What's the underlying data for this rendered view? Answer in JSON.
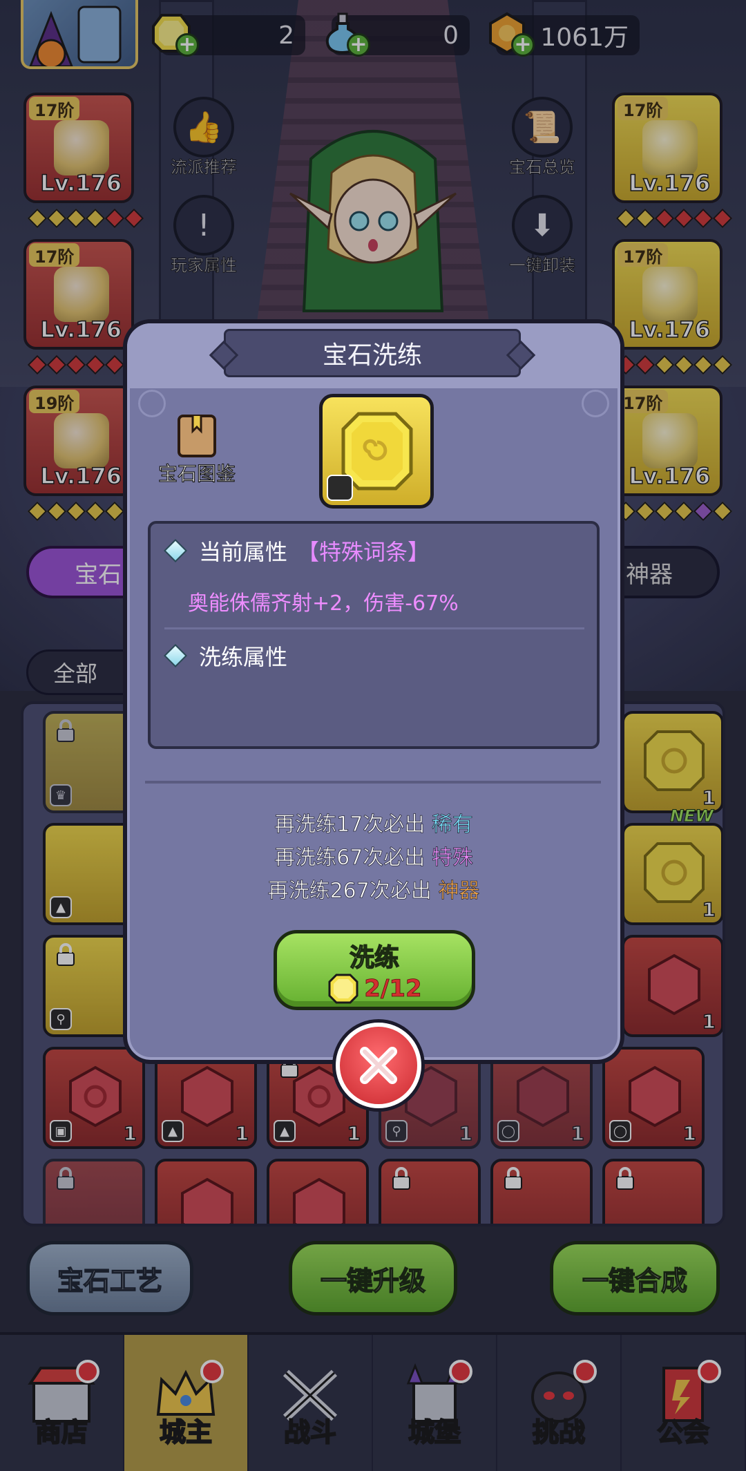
{
  "currencies": [
    {
      "name": "gold-gem-currency",
      "value": "2"
    },
    {
      "name": "potion-currency",
      "value": "0"
    },
    {
      "name": "coin-currency",
      "value": "1061万"
    }
  ],
  "equipment_left": [
    {
      "tier": "17阶",
      "level": "Lv.176",
      "item": "hat"
    },
    {
      "tier": "17阶",
      "level": "Lv.176",
      "item": "armor"
    },
    {
      "tier": "19阶",
      "level": "Lv.176",
      "item": "boots"
    }
  ],
  "equipment_right": [
    {
      "tier": "17阶",
      "level": "Lv.176",
      "item": "staff"
    },
    {
      "tier": "17阶",
      "level": "Lv.176",
      "item": "ring"
    },
    {
      "tier": "17阶",
      "level": "Lv.176",
      "item": "necklace"
    }
  ],
  "menu": {
    "build_recommend": "流派推荐",
    "player_attributes": "玩家属性",
    "gem_overview": "宝石总览",
    "unequip_all": "一键卸装"
  },
  "tabs": {
    "gem_tab": "宝石",
    "artifact_tab": "神器",
    "filter_all": "全部"
  },
  "inventory_counts": {
    "count": "1",
    "new_tag": "NEW"
  },
  "bottom_buttons": {
    "craft": "宝石工艺",
    "upgrade_all": "一键升级",
    "merge_all": "一键合成"
  },
  "nav": [
    {
      "label": "商店",
      "badge": true
    },
    {
      "label": "城主",
      "badge": true,
      "active": true
    },
    {
      "label": "战斗",
      "badge": false
    },
    {
      "label": "城堡",
      "badge": true
    },
    {
      "label": "挑战",
      "badge": true
    },
    {
      "label": "公会",
      "badge": true
    }
  ],
  "modal": {
    "title": "宝石洗练",
    "codex_label": "宝石图鉴",
    "current_attr_label": "当前属性",
    "current_attr_tag": "【特殊词条】",
    "current_attr_value": "奥能侏儒齐射+2，伤害-67%",
    "refine_attr_label": "洗练属性",
    "pity": [
      {
        "prefix": "再洗练17次必出",
        "rarity": "稀有"
      },
      {
        "prefix": "再洗练67次必出",
        "rarity": "特殊"
      },
      {
        "prefix": "再洗练267次必出",
        "rarity": "神器"
      }
    ],
    "refine_button": "洗练",
    "refine_cost": "2/12"
  },
  "colors": {
    "rare": "#7ae4ff",
    "special": "#f08dff",
    "artifact": "#ffae4b",
    "cost_red": "#d2302f"
  }
}
